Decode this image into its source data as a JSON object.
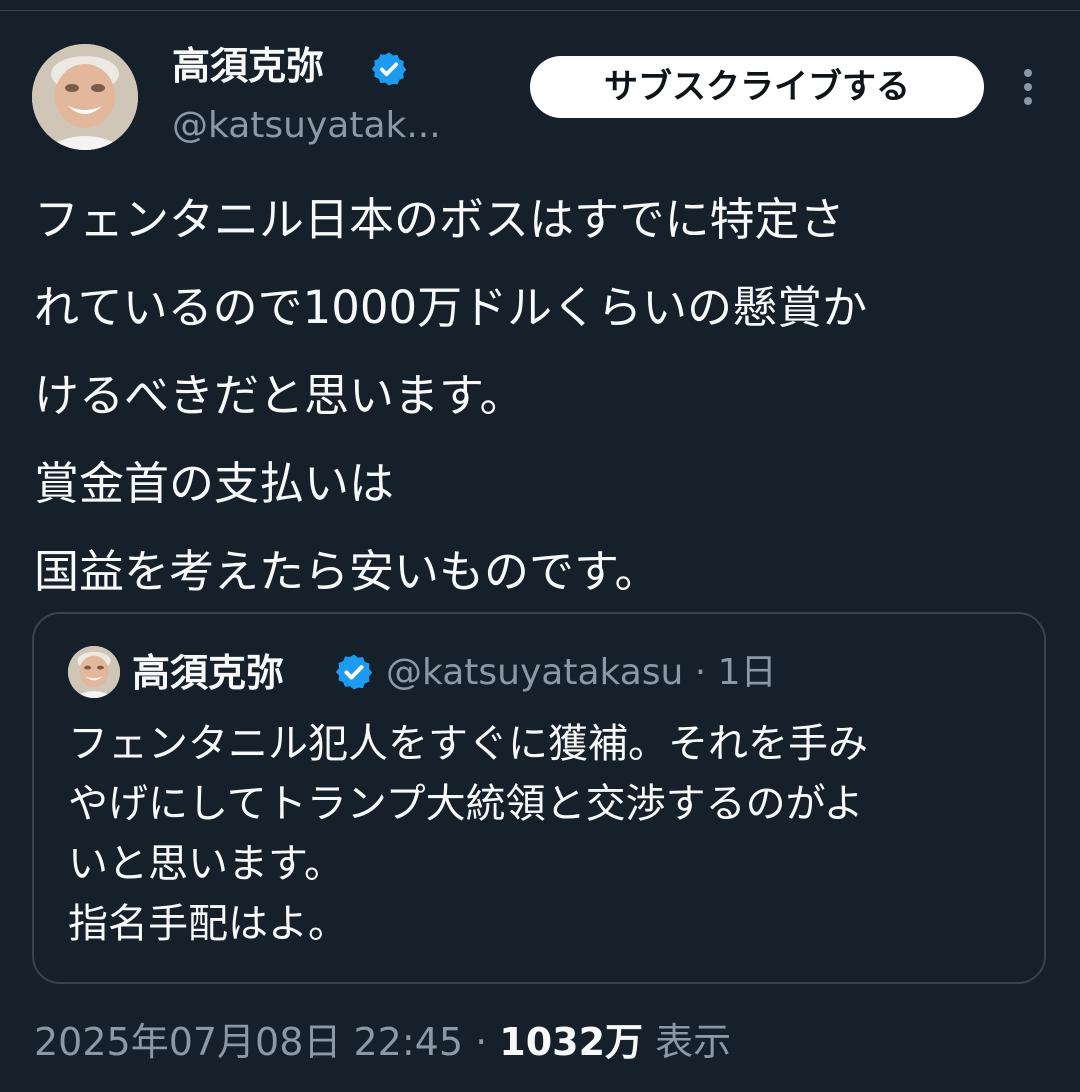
{
  "author": {
    "display_name": "高須克弥",
    "handle": "@katsuyatak...",
    "verified_icon": "verified-badge-icon"
  },
  "actions": {
    "subscribe_label": "サブスクライブする",
    "more_icon": "more-vertical-icon"
  },
  "tweet": {
    "lines": [
      "フェンタニル日本のボスはすでに特定さ",
      "れているので1000万ドルくらいの懸賞か",
      "けるべきだと思います。",
      "賞金首の支払いは",
      "国益を考えたら安いものです。"
    ]
  },
  "quoted_tweet": {
    "display_name": "高須克弥",
    "meta": "@katsuyatakasu · 1日",
    "lines": [
      "フェンタニル犯人をすぐに獲補。それを手み",
      "やげにしてトランプ大統領と交渉するのがよ",
      "いと思います。",
      "指名手配はよ。"
    ]
  },
  "meta": {
    "timestamp": "2025年07月08日 22:45 · ",
    "views_count": "1032万",
    "views_label": " 表示"
  },
  "colors": {
    "background": "#15202b",
    "text_primary": "#f7f9f9",
    "text_secondary": "#8b98a5",
    "border": "#38444d",
    "verified_blue": "#1d9bf0"
  }
}
